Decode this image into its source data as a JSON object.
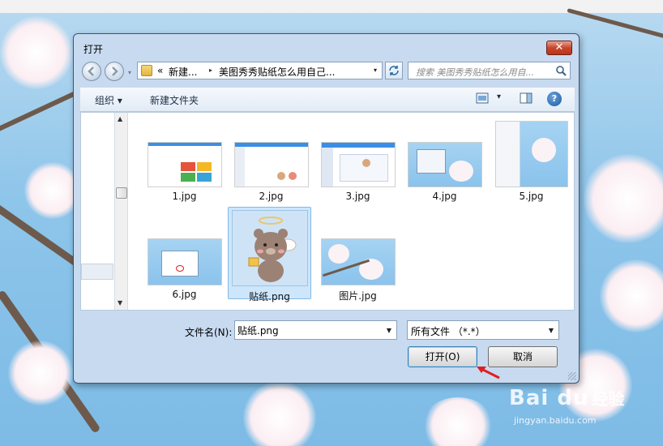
{
  "dialog": {
    "title": "打开",
    "close_glyph": "✕"
  },
  "address_bar": {
    "prefix": "«",
    "crumbs": [
      "新建...",
      "美图秀秀贴纸怎么用自己..."
    ],
    "separator": "▸",
    "dropdown_glyph": "▾"
  },
  "search": {
    "placeholder": "搜索 美图秀秀贴纸怎么用自..."
  },
  "toolbar": {
    "organize_label": "组织 ▾",
    "new_folder_label": "新建文件夹",
    "view_dropdown_glyph": "▾",
    "help_glyph": "?"
  },
  "files": [
    {
      "name": "1.jpg",
      "selected": false
    },
    {
      "name": "2.jpg",
      "selected": false
    },
    {
      "name": "3.jpg",
      "selected": false
    },
    {
      "name": "4.jpg",
      "selected": false
    },
    {
      "name": "5.jpg",
      "selected": false
    },
    {
      "name": "6.jpg",
      "selected": false
    },
    {
      "name": "贴纸.png",
      "selected": true
    },
    {
      "name": "图片.jpg",
      "selected": false
    }
  ],
  "filename": {
    "label": "文件名(N):",
    "value": "贴纸.png"
  },
  "filter": {
    "value": "所有文件 （*.*）"
  },
  "buttons": {
    "open_label": "打开(O)",
    "cancel_label": "取消"
  },
  "watermark": {
    "logo": "Bai du",
    "suffix": "经验",
    "url": "jingyan.baidu.com"
  },
  "icons": {
    "back": "back-arrow-icon",
    "forward": "forward-arrow-icon",
    "folder": "folder-icon",
    "refresh": "refresh-icon",
    "search": "magnifier-icon",
    "view": "view-mode-icon",
    "preview": "preview-pane-icon",
    "help": "help-icon"
  },
  "colors": {
    "dialog_frame": "#c7daf0",
    "close_button": "#c8452b",
    "selection": "#cde6fb",
    "annotation_arrow": "#e02020"
  }
}
